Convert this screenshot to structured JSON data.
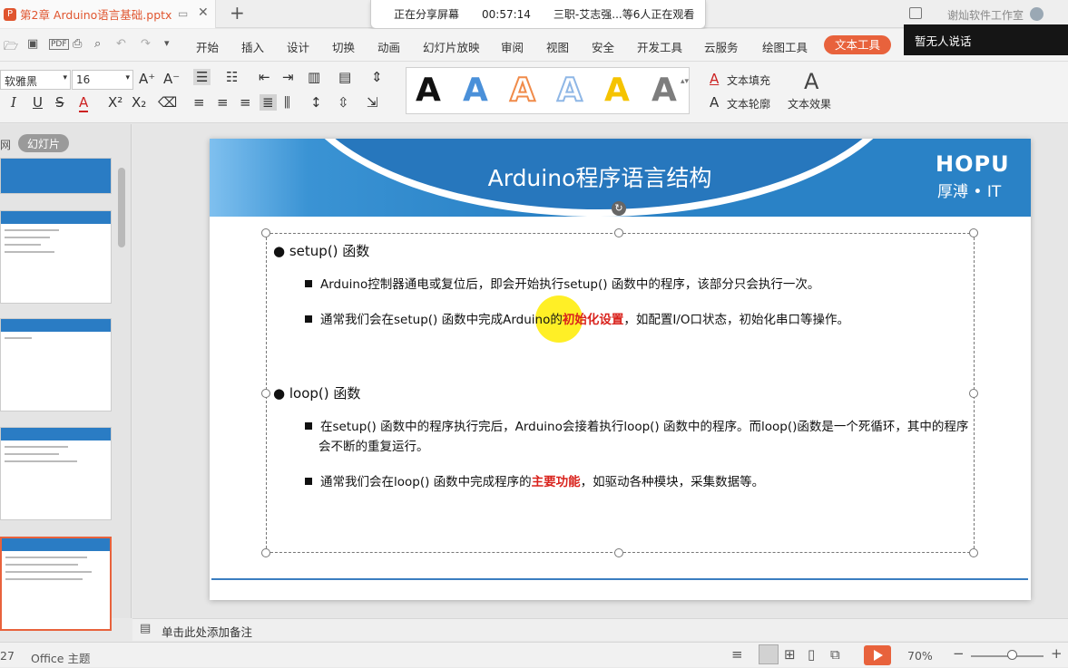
{
  "titlebar": {
    "doc_name": "第2章 Arduino语言基础.pptx",
    "add_tab": "+",
    "user_label": "谢灿软件工作室"
  },
  "share_bar": {
    "status": "正在分享屏幕",
    "time": "00:57:14",
    "viewers": "三职-艾志强...等6人正在观看"
  },
  "overlay": {
    "speaker": "暂无人说话"
  },
  "menu": {
    "items": [
      "开始",
      "插入",
      "设计",
      "切换",
      "动画",
      "幻灯片放映",
      "审阅",
      "视图",
      "安全",
      "开发工具",
      "云服务",
      "绘图工具"
    ],
    "active": "文本工具"
  },
  "toolbar": {
    "font_name": "软雅黑",
    "font_size": "16",
    "text_fill": "文本填充",
    "text_outline": "文本轮廓",
    "text_effect": "文本效果",
    "style_letter": "A",
    "style_colors": [
      "#111111",
      "#4a90d9",
      "#f08b4a",
      "#8fb7e6",
      "#f5c300",
      "#7d7d7d"
    ]
  },
  "leftpane": {
    "tab_outline": "网",
    "tab_slides": "幻灯片"
  },
  "slide": {
    "title": "Arduino程序语言结构",
    "logo": "HOPU",
    "logo_sub": "厚溥 • IT",
    "b1": "setup() 函数",
    "b1_1": "Arduino控制器通电或复位后，即会开始执行setup() 函数中的程序，该部分只会执行一次。",
    "b1_2_pre": "通常我们会在setup() 函数中完成Arduino的",
    "b1_2_red": "初始化设置",
    "b1_2_post": "，如配置I/O口状态，初始化串口等操作。",
    "b2": "loop() 函数",
    "b2_1": "在setup() 函数中的程序执行完后，Arduino会接着执行loop() 函数中的程序。而loop()函数是一个死循环，其中的程序会不断的重复运行。",
    "b2_2_pre": "通常我们会在loop() 函数中完成程序的",
    "b2_2_red": "主要功能",
    "b2_2_post": "，如驱动各种模块，采集数据等。"
  },
  "notes": {
    "placeholder": "单击此处添加备注"
  },
  "status": {
    "page": "27",
    "theme": "Office 主题",
    "zoom": "70%"
  }
}
